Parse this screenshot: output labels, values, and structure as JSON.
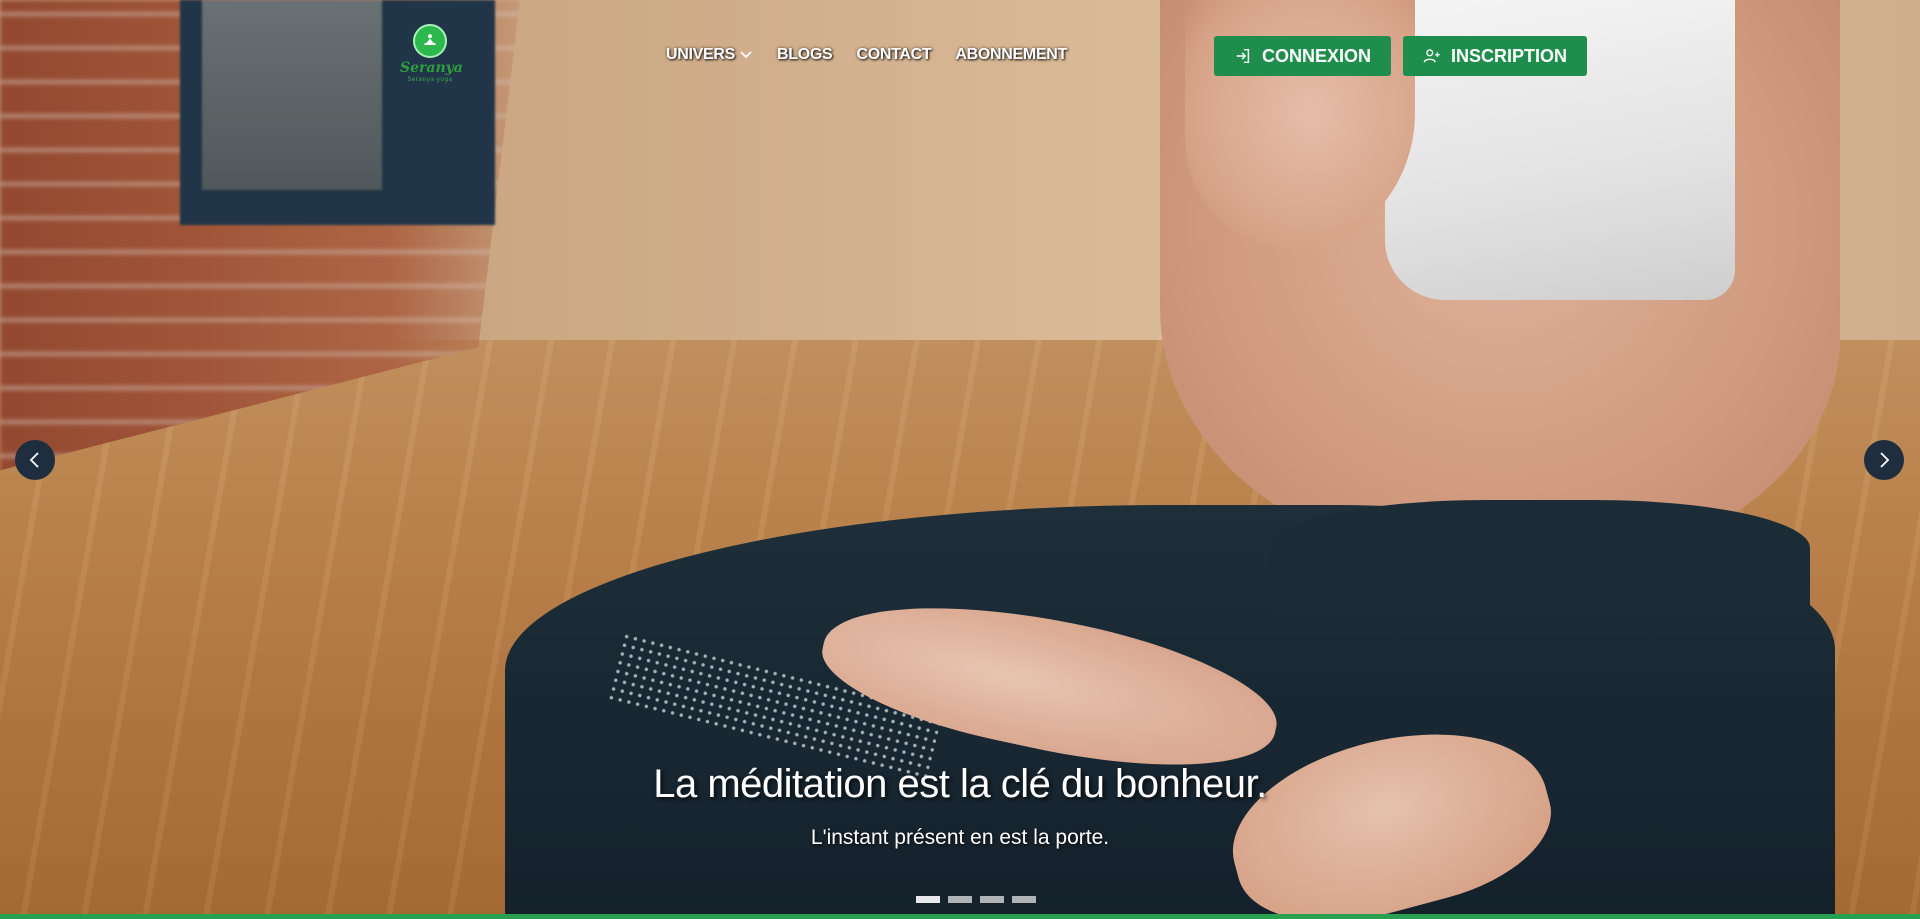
{
  "brand": {
    "name": "Seranya",
    "tagline": "Seranya yoga",
    "accent": "#1f8e4d"
  },
  "nav": {
    "items": [
      {
        "label": "UNIVERS",
        "has_dropdown": true,
        "icon": "chevron-down-icon"
      },
      {
        "label": "BLOGS"
      },
      {
        "label": "CONTACT"
      },
      {
        "label": "ABONNEMENT"
      }
    ]
  },
  "auth": {
    "login_label": "CONNEXION",
    "login_icon": "login-icon",
    "signup_label": "INSCRIPTION",
    "signup_icon": "user-plus-icon"
  },
  "carousel": {
    "prev_icon": "chevron-left-icon",
    "next_icon": "chevron-right-icon",
    "slide_title": "La méditation est la clé du bonheur.",
    "slide_subtitle": "L'instant présent en est la porte.",
    "slide_count": 4,
    "active_index": 0
  }
}
